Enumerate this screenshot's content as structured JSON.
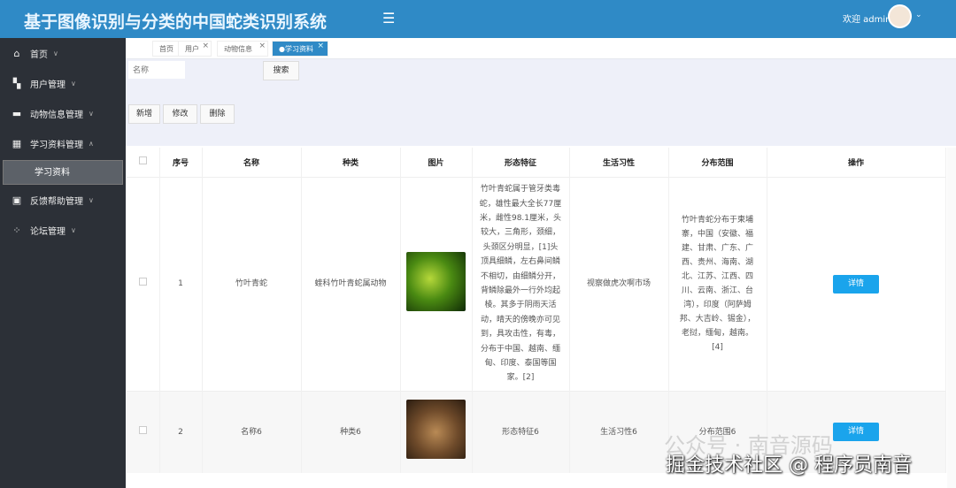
{
  "header": {
    "title": "基于图像识别与分类的中国蛇类识别系统",
    "welcome": "欢迎 admin"
  },
  "sidebar": {
    "items": [
      {
        "label": "首页",
        "icon": "home-icon"
      },
      {
        "label": "用户管理",
        "icon": "user-icon"
      },
      {
        "label": "动物信息管理",
        "icon": "animal-icon"
      },
      {
        "label": "学习资料管理",
        "icon": "layout-icon"
      },
      {
        "label": "反馈帮助管理",
        "icon": "chip-icon"
      },
      {
        "label": "论坛管理",
        "icon": "grid-icon"
      }
    ],
    "sub_item": "学习资料"
  },
  "tabs": [
    {
      "label": "首页"
    },
    {
      "label": "用户"
    },
    {
      "label": "动物信息"
    },
    {
      "label": "●学习资料"
    }
  ],
  "search": {
    "placeholder": "名称",
    "button": "搜索"
  },
  "actions": {
    "add": "新增",
    "edit": "修改",
    "delete": "删除"
  },
  "table": {
    "headers": [
      "序号",
      "名称",
      "种类",
      "图片",
      "形态特征",
      "生活习性",
      "分布范围",
      "操作"
    ],
    "rows": [
      {
        "index": "1",
        "name": "竹叶青蛇",
        "type": "蝰科竹叶青蛇属动物",
        "morphology": "竹叶青蛇属于管牙类毒蛇，雄性最大全长77厘米，雌性98.1厘米，头较大，三角形，颈细，头颈区分明显，[1]头顶具细鳞，左右鼻间鳞不相切，由细鳞分开，背鳞除最外一行外均起棱。其多于阴雨天活动，晴天的傍晚亦可见到，具攻击性，有毒，分布于中国、越南、缅甸、印度、泰国等国家。[2]",
        "habits": "视察做虎次啊市场",
        "distribution": "竹叶青蛇分布于柬埔寨，中国（安徽、福建、甘肃、广东、广西、贵州、海南、湖北、江苏、江西、四川、云南、浙江、台湾），印度（阿萨姆邦、大吉岭、锡金），老挝，缅甸，越南。[4]",
        "action": "详情"
      },
      {
        "index": "2",
        "name": "名称6",
        "type": "种类6",
        "morphology": "形态特征6",
        "habits": "生活习性6",
        "distribution": "分布范围6",
        "action": "详情"
      }
    ]
  },
  "watermark": {
    "line1": "公众号 · 南音源码",
    "line2": "掘金技术社区 @ 程序员南音"
  }
}
